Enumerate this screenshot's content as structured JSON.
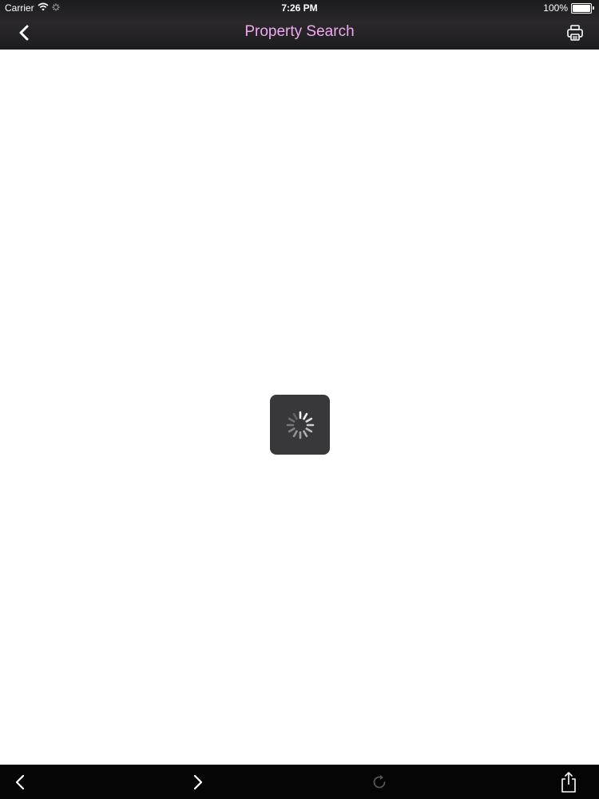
{
  "status_bar": {
    "carrier": "Carrier",
    "time": "7:26 PM",
    "battery": "100%",
    "battery_level": 1.0
  },
  "nav_bar": {
    "title": "Property Search",
    "title_color": "#f0a8f0",
    "back_icon": "chevron-left-icon",
    "print_icon": "printer-icon"
  },
  "content": {
    "loading": true
  },
  "toolbar": {
    "back_icon": "chevron-left-icon",
    "forward_icon": "chevron-right-icon",
    "reload_icon": "reload-icon",
    "share_icon": "share-icon"
  }
}
